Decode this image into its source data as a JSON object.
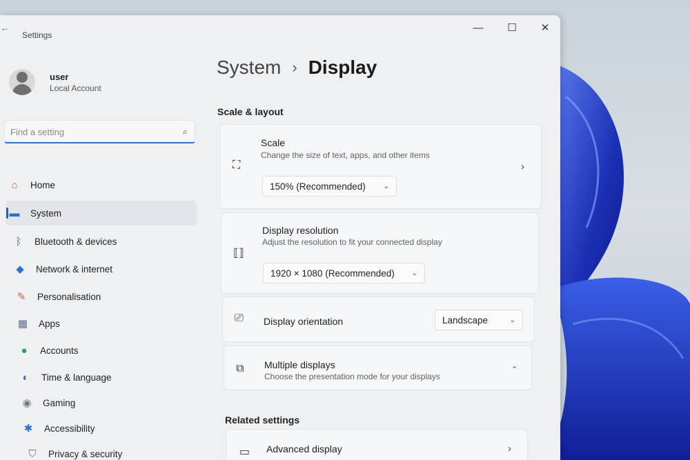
{
  "window": {
    "title": "Settings",
    "controls": {
      "minimize": "—",
      "maximize": "☐",
      "close": "✕"
    }
  },
  "user": {
    "name": "user",
    "account_type": "Local Account"
  },
  "search": {
    "placeholder": "Find a setting"
  },
  "nav": [
    {
      "label": "Home",
      "icon": "home-icon",
      "glyph": "⌂",
      "color": "#c96a2b"
    },
    {
      "label": "System",
      "icon": "monitor-icon",
      "glyph": "▬",
      "color": "#2a73c8",
      "active": true
    },
    {
      "label": "Bluetooth & devices",
      "icon": "bluetooth-icon",
      "glyph": "ᛒ",
      "color": "#2a73c8"
    },
    {
      "label": "Network & internet",
      "icon": "wifi-icon",
      "glyph": "◆",
      "color": "#2a73c8"
    },
    {
      "label": "Personalisation",
      "icon": "paintbrush-icon",
      "glyph": "✎",
      "color": "#c0603a"
    },
    {
      "label": "Apps",
      "icon": "apps-icon",
      "glyph": "▦",
      "color": "#5a6f86"
    },
    {
      "label": "Accounts",
      "icon": "person-icon",
      "glyph": "●",
      "color": "#2f9a6f"
    },
    {
      "label": "Time & language",
      "icon": "globe-icon",
      "glyph": "◐",
      "color": "#2a73c8"
    },
    {
      "label": "Gaming",
      "icon": "gamepad-icon",
      "glyph": "◉",
      "color": "#6f7a85"
    },
    {
      "label": "Accessibility",
      "icon": "accessibility-icon",
      "glyph": "✱",
      "color": "#2a73c8"
    },
    {
      "label": "Privacy & security",
      "icon": "shield-icon",
      "glyph": "⛉",
      "color": "#6f7a85"
    }
  ],
  "breadcrumb": {
    "parent": "System",
    "separator": "›",
    "current": "Display"
  },
  "scale_layout": {
    "section_title": "Scale & layout",
    "scale": {
      "title": "Scale",
      "subtitle": "Change the size of text, apps, and other items",
      "value": "150% (Recommended)"
    },
    "resolution": {
      "title": "Display resolution",
      "subtitle": "Adjust the resolution to fit your connected display",
      "value": "1920 × 1080 (Recommended)"
    },
    "orientation": {
      "title": "Display orientation",
      "value": "Landscape"
    },
    "multiple": {
      "title": "Multiple displays",
      "subtitle": "Choose the presentation mode for your displays"
    }
  },
  "related": {
    "section_title": "Related settings",
    "advanced": {
      "title": "Advanced display"
    }
  },
  "colors": {
    "accent": "#1f62c2",
    "wallpaper_blue": "#1a2fb8"
  }
}
